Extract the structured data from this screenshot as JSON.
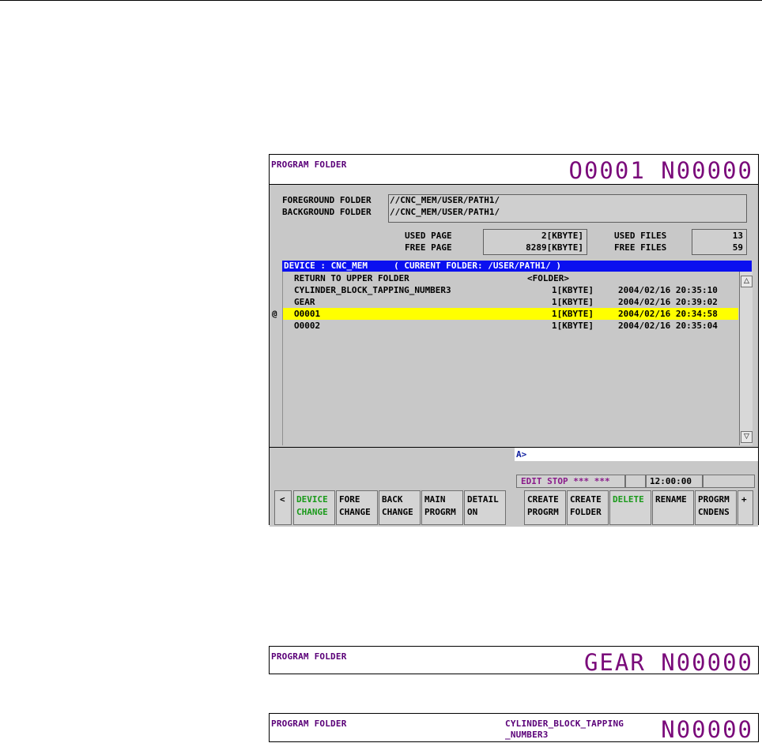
{
  "main_screen": {
    "title": "PROGRAM FOLDER",
    "program_number": "O0001 N00000",
    "foreground_label": "FOREGROUND FOLDER",
    "foreground_path": "//CNC_MEM/USER/PATH1/",
    "background_label": "BACKGROUND FOLDER",
    "background_path": "//CNC_MEM/USER/PATH1/",
    "used_page_label": "USED PAGE",
    "used_page_value": "2[KBYTE]",
    "free_page_label": "FREE PAGE",
    "free_page_value": "8289[KBYTE]",
    "used_files_label": "USED FILES",
    "used_files_value": "13",
    "free_files_label": "FREE FILES",
    "free_files_value": "59",
    "device_header": "DEVICE : CNC_MEM     ( CURRENT FOLDER: /USER/PATH1/ )",
    "files": [
      {
        "marker": "",
        "name": "RETURN TO UPPER FOLDER",
        "size": "<FOLDER>",
        "date": ""
      },
      {
        "marker": "",
        "name": "CYLINDER_BLOCK_TAPPING_NUMBER3",
        "size": "1[KBYTE]",
        "date": "2004/02/16 20:35:10"
      },
      {
        "marker": "",
        "name": "GEAR",
        "size": "1[KBYTE]",
        "date": "2004/02/16 20:39:02"
      },
      {
        "marker": "@",
        "name": "O0001",
        "size": "1[KBYTE]",
        "date": "2004/02/16 20:34:58"
      },
      {
        "marker": "",
        "name": "O0002",
        "size": "1[KBYTE]",
        "date": "2004/02/16 20:35:04"
      }
    ],
    "scroll_up": "△",
    "scroll_down": "▽",
    "input_prompt": "A>",
    "status_mode": "EDIT STOP *** ***",
    "status_time": "12:00:00",
    "softkeys": {
      "left_arrow": "<",
      "device_change": [
        "DEVICE",
        "CHANGE"
      ],
      "fore_change": [
        "FORE",
        "CHANGE"
      ],
      "back_change": [
        "BACK",
        "CHANGE"
      ],
      "main_progrm": [
        "MAIN",
        "PROGRM"
      ],
      "detail_on": [
        "DETAIL",
        "ON"
      ],
      "create_progrm": [
        "CREATE",
        "PROGRM"
      ],
      "create_folder": [
        "CREATE",
        "FOLDER"
      ],
      "delete": "DELETE",
      "rename": "RENAME",
      "progrm_cndens": [
        "PROGRM",
        "CNDENS"
      ],
      "plus": "+"
    }
  },
  "strip_gear": {
    "title": "PROGRAM FOLDER",
    "program_number": "GEAR N00000"
  },
  "strip_cylinder": {
    "title": "PROGRAM FOLDER",
    "name_line1": "CYLINDER_BLOCK_TAPPING",
    "name_line2": "_NUMBER3",
    "program_number": "N00000"
  },
  "colors": {
    "title_purple": "#7a0a7a",
    "device_bar_blue": "#0a10f0",
    "selected_row_yellow": "#ffff00",
    "softkey_green": "#1a9a1a",
    "status_purple": "#8a1a8a"
  }
}
